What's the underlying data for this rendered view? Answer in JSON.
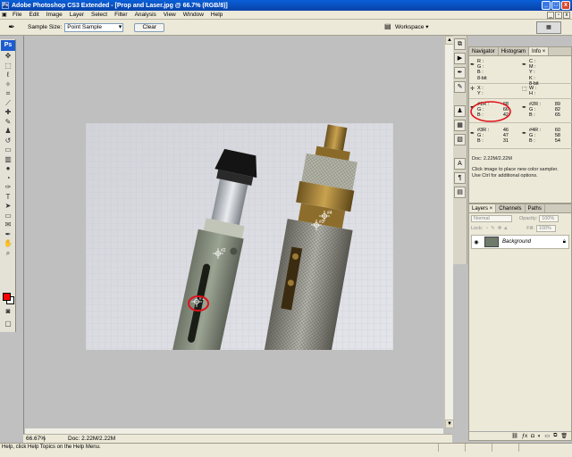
{
  "titlebar": {
    "title": "Adobe Photoshop CS3 Extended - [Prop and Laser.jpg @ 66.7% (RGB/8)]",
    "minimize": "_",
    "maximize": "□",
    "close": "x"
  },
  "menubar": {
    "items": [
      "File",
      "Edit",
      "Image",
      "Layer",
      "Select",
      "Filter",
      "Analysis",
      "View",
      "Window",
      "Help"
    ]
  },
  "options": {
    "sample_size_label": "Sample Size:",
    "sample_size_value": "Point Sample",
    "clear_button": "Clear",
    "workspace_label": "Workspace ▾"
  },
  "toolbox": {
    "logo": "Ps"
  },
  "document": {
    "zoom": "66.67%",
    "doc_size": "Doc: 2.22M/2.22M",
    "sampler_labels": [
      "#1",
      "#2",
      "#3",
      "#4"
    ]
  },
  "info_panel": {
    "tabs": [
      "Navigator",
      "Histogram",
      "Info ×"
    ],
    "rgb_block": {
      "labels": [
        "R :",
        "G :",
        "B :"
      ],
      "mode": "8-bit"
    },
    "cmyk_block": {
      "labels": [
        "C :",
        "M :",
        "Y :",
        "K :"
      ],
      "mode": "8-bit"
    },
    "xy_block": {
      "labels": [
        "X :",
        "Y :"
      ]
    },
    "wh_block": {
      "labels": [
        "W :",
        "H :"
      ]
    },
    "samplers": [
      {
        "labels": [
          "#1R :",
          "G :",
          "B :"
        ],
        "values": [
          "68",
          "66",
          "42"
        ]
      },
      {
        "labels": [
          "#2R :",
          "G :",
          "B :"
        ],
        "values": [
          "89",
          "82",
          "65"
        ]
      },
      {
        "labels": [
          "#3R :",
          "G :",
          "B :"
        ],
        "values": [
          "46",
          "47",
          "31"
        ]
      },
      {
        "labels": [
          "#4R :",
          "G :",
          "B :"
        ],
        "values": [
          "60",
          "58",
          "54"
        ]
      }
    ],
    "doc_line": "Doc: 2.22M/2.22M",
    "hint_1": "Click image to place new color sampler.",
    "hint_2": "Use Ctrl for additional options."
  },
  "layers_panel": {
    "tabs": [
      "Layers ×",
      "Channels",
      "Paths"
    ],
    "blend_mode": "Normal",
    "opacity_label": "Opacity:",
    "opacity_value": "100%",
    "lock_label": "Lock:",
    "fill_label": "Fill:",
    "fill_value": "100%",
    "layer_name": "Background"
  },
  "status": {
    "help": "Help, click Help Topics on the Help Menu."
  }
}
